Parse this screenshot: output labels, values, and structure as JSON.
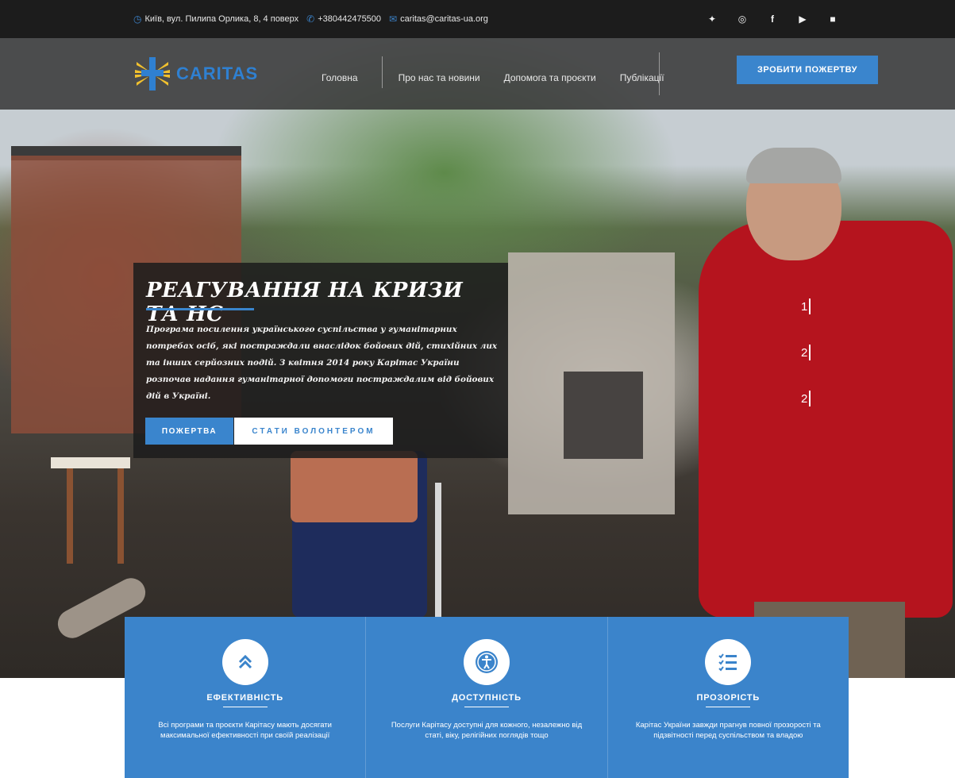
{
  "topbar": {
    "address": "Київ, вул. Пилипа Орлика, 8, 4 поверх",
    "phone": "+380442475500",
    "email": "caritas@caritas-ua.org",
    "address_icon": "clock-icon",
    "phone_icon": "phone-icon",
    "email_icon": "mail-icon",
    "socials": [
      {
        "name": "twitter-icon",
        "glyph": "🐦"
      },
      {
        "name": "instagram-icon",
        "glyph": "◎"
      },
      {
        "name": "facebook-icon",
        "glyph": "f"
      },
      {
        "name": "youtube-icon",
        "glyph": "▶"
      },
      {
        "name": "linkedin-icon",
        "glyph": "■"
      }
    ]
  },
  "nav": {
    "logo_text": "CARITAS",
    "menu": [
      "Головна",
      "Про нас та новини",
      "Допомога та проєкти",
      "Публікації"
    ],
    "donate_button": "ЗРОБИТИ ПОЖЕРТВУ"
  },
  "slide": {
    "title": "РЕАГУВАННЯ НА КРИЗИ ТА НС",
    "text": "Програма посилення українського суспільства у гуманітарних потребах осіб, які постраждали внаслідок бойових дій, стихійних лих та інших серйозних подій. З квітня 2014 року Карітас України розпочав надання гуманітарної допомоги постраждалим від бойових дій в Україні.",
    "donate_button": "ПОЖЕРТВА",
    "volunteer_button": "СТАТИ ВОЛОНТЕРОМ",
    "numbers": [
      "1",
      "2",
      "2"
    ]
  },
  "features": [
    {
      "icon": "chevron-double-up-icon",
      "title": "ЕФЕКТИВНІСТЬ",
      "text": "Всі програми та проєкти Карітасу мають досягати максимальної ефективності при своїй реалізації"
    },
    {
      "icon": "accessibility-icon",
      "title": "ДОСТУПНІСТЬ",
      "text": "Послуги Карітасу доступні для кожного, незалежно від статі, віку, релігійних поглядів тощо"
    },
    {
      "icon": "checklist-icon",
      "title": "ПРОЗОРІСТЬ",
      "text": "Карітас України завжди прагнув повної прозорості та підзвітності перед суспільством та владою"
    }
  ],
  "colors": {
    "accent": "#3a85cd",
    "topbar": "#1c1c1c",
    "feature_bg": "#3b84cb"
  }
}
